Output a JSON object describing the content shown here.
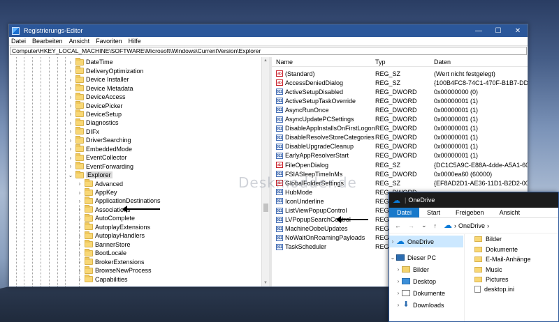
{
  "registry_editor": {
    "title": "Registrierungs-Editor",
    "menu": [
      "Datei",
      "Bearbeiten",
      "Ansicht",
      "Favoriten",
      "Hilfe"
    ],
    "address": "Computer\\HKEY_LOCAL_MACHINE\\SOFTWARE\\Microsoft\\Windows\\CurrentVersion\\Explorer",
    "tree": {
      "parent_items": [
        "DateTime",
        "DeliveryOptimization",
        "Device Installer",
        "Device Metadata",
        "DeviceAccess",
        "DevicePicker",
        "DeviceSetup",
        "Diagnostics",
        "DIFx",
        "DriverSearching",
        "EmbeddedMode",
        "EventCollector",
        "EventForwarding"
      ],
      "selected": "Explorer",
      "child_items": [
        "Advanced",
        "AppKey",
        "ApplicationDestinations",
        "Associations",
        "AutoComplete",
        "AutoplayExtensions",
        "AutoplayHandlers",
        "BannerStore",
        "BootLocale",
        "BrokerExtensions",
        "BrowseNewProcess",
        "Capabilities"
      ]
    },
    "columns": {
      "name": "Name",
      "type": "Typ",
      "data": "Daten"
    },
    "values": [
      {
        "icon": "string-value-icon",
        "name": "(Standard)",
        "type": "REG_SZ",
        "data": "(Wert nicht festgelegt)"
      },
      {
        "icon": "string-value-icon",
        "name": "AccessDeniedDialog",
        "type": "REG_SZ",
        "data": "{100B4FC8-74C1-470F-B1B7-DD7B6B"
      },
      {
        "icon": "dword-value-icon",
        "name": "ActiveSetupDisabled",
        "type": "REG_DWORD",
        "data": "0x00000000 (0)"
      },
      {
        "icon": "dword-value-icon",
        "name": "ActiveSetupTaskOverride",
        "type": "REG_DWORD",
        "data": "0x00000001 (1)"
      },
      {
        "icon": "dword-value-icon",
        "name": "AsyncRunOnce",
        "type": "REG_DWORD",
        "data": "0x00000001 (1)"
      },
      {
        "icon": "dword-value-icon",
        "name": "AsyncUpdatePCSettings",
        "type": "REG_DWORD",
        "data": "0x00000001 (1)"
      },
      {
        "icon": "dword-value-icon",
        "name": "DisableAppInstallsOnFirstLogon",
        "type": "REG_DWORD",
        "data": "0x00000001 (1)"
      },
      {
        "icon": "dword-value-icon",
        "name": "DisableResolveStoreCategories",
        "type": "REG_DWORD",
        "data": "0x00000001 (1)"
      },
      {
        "icon": "dword-value-icon",
        "name": "DisableUpgradeCleanup",
        "type": "REG_DWORD",
        "data": "0x00000001 (1)"
      },
      {
        "icon": "dword-value-icon",
        "name": "EarlyAppResolverStart",
        "type": "REG_DWORD",
        "data": "0x00000001 (1)"
      },
      {
        "icon": "string-value-icon",
        "name": "FileOpenDialog",
        "type": "REG_SZ",
        "data": "{DC1C5A9C-E88A-4dde-A5A1-60F82"
      },
      {
        "icon": "dword-value-icon",
        "name": "FSIASleepTimeInMs",
        "type": "REG_DWORD",
        "data": "0x0000ea60 (60000)"
      },
      {
        "icon": "string-value-icon",
        "name": "GlobalFolderSettings",
        "type": "REG_SZ",
        "data": "{EF8AD2D1-AE36-11D1-B2D2-006097"
      },
      {
        "icon": "dword-value-icon",
        "name": "HubMode",
        "type": "REG_DWORD",
        "data": ""
      },
      {
        "icon": "dword-value-icon",
        "name": "IconUnderline",
        "type": "REG_DWORD",
        "data": ""
      },
      {
        "icon": "dword-value-icon",
        "name": "ListViewPopupControl",
        "type": "REG_DWORD",
        "data": ""
      },
      {
        "icon": "dword-value-icon",
        "name": "LVPopupSearchControl",
        "type": "REG_DWORD",
        "data": ""
      },
      {
        "icon": "dword-value-icon",
        "name": "MachineOobeUpdates",
        "type": "REG_DWORD",
        "data": ""
      },
      {
        "icon": "dword-value-icon",
        "name": "NoWaitOnRoamingPayloads",
        "type": "REG_DWORD",
        "data": ""
      },
      {
        "icon": "dword-value-icon",
        "name": "TaskScheduler",
        "type": "REG_DWORD",
        "data": ""
      }
    ],
    "watermark": "Deskmodder.de"
  },
  "onedrive_window": {
    "title": "OneDrive",
    "ribbon_tabs": [
      "Datei",
      "Start",
      "Freigeben",
      "Ansicht"
    ],
    "breadcrumb": "OneDrive",
    "nav_items": [
      {
        "label": "OneDrive",
        "icon": "cloud-icon"
      },
      {
        "label": "Dieser PC",
        "icon": "pc-icon"
      },
      {
        "label": "Bilder",
        "icon": "pictures-icon"
      },
      {
        "label": "Desktop",
        "icon": "desktop-icon"
      },
      {
        "label": "Dokumente",
        "icon": "documents-icon"
      },
      {
        "label": "Downloads",
        "icon": "downloads-icon"
      }
    ],
    "files": [
      "Bilder",
      "Dokumente",
      "E-Mail-Anhänge",
      "Music",
      "Pictures",
      "desktop.ini"
    ]
  }
}
